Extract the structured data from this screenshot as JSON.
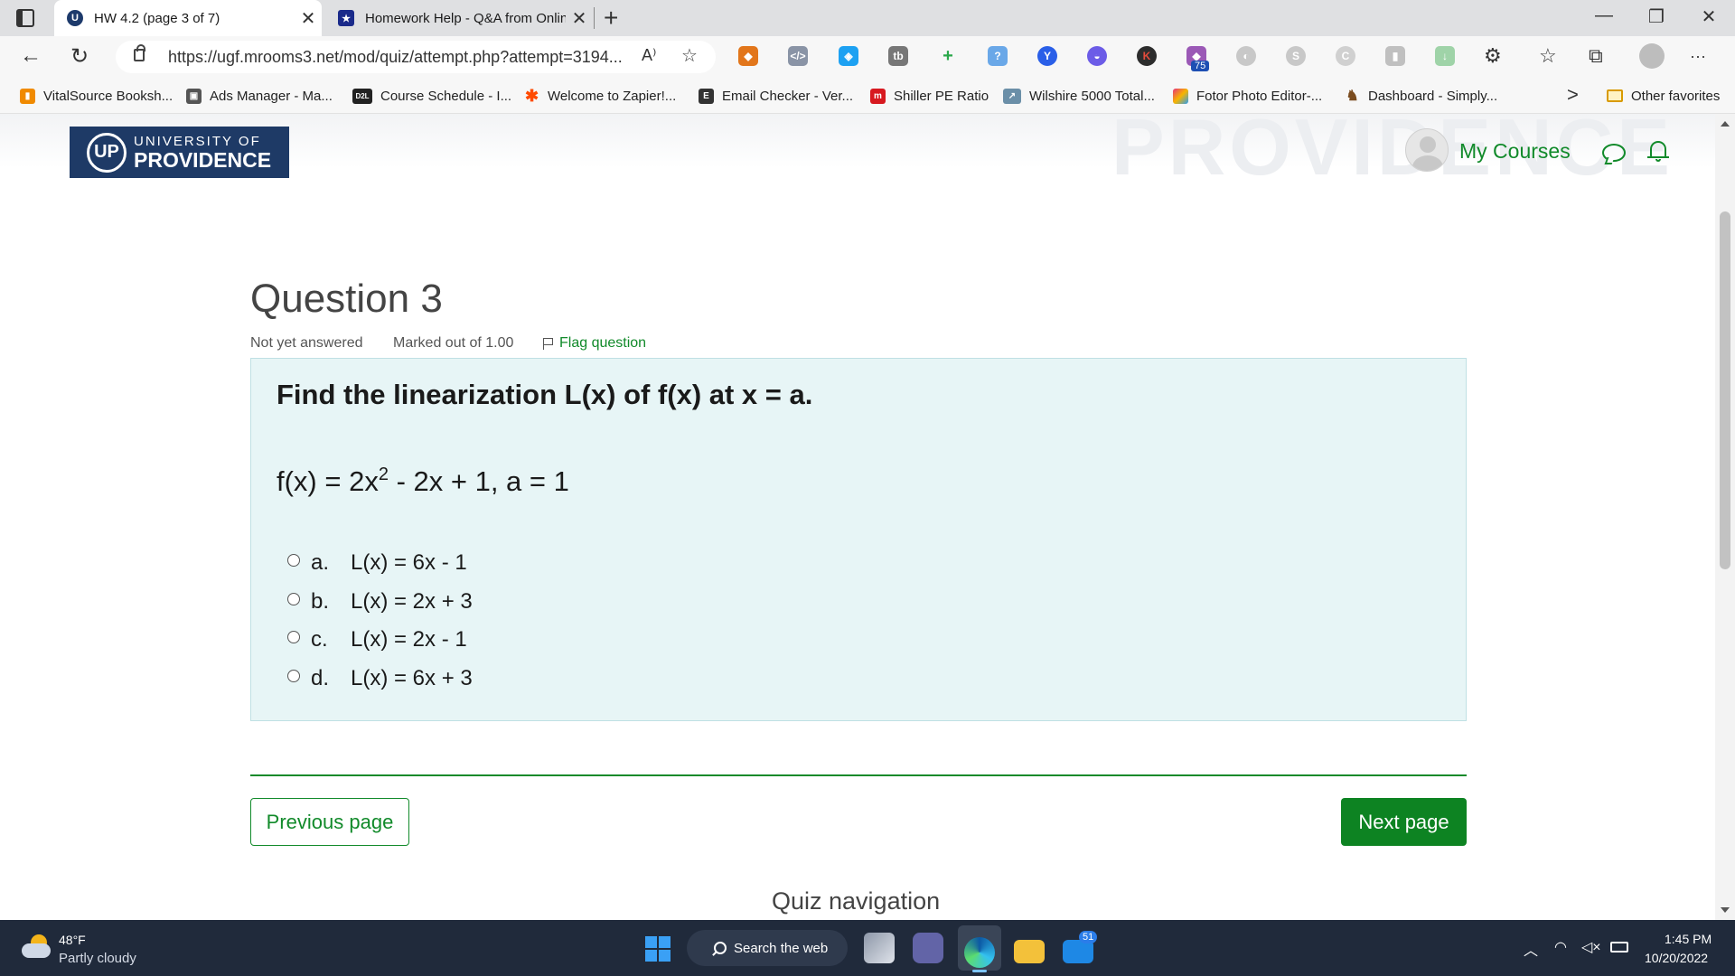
{
  "browser": {
    "tabs": [
      {
        "title": "HW 4.2 (page 3 of 7)",
        "active": true,
        "icon": "providence-logo-icon"
      },
      {
        "title": "Homework Help - Q&A from Online Tutors",
        "active": false,
        "icon": "star-badge-icon"
      }
    ],
    "close_glyph": "✕",
    "newtab_glyph": "+",
    "window_controls": {
      "minimize": "—",
      "restore": "❐",
      "close": "✕"
    },
    "nav": {
      "back": "←",
      "refresh": "↻"
    },
    "url": "https://ugf.mrooms3.net/mod/quiz/attempt.php?attempt=3194...",
    "read_aloud": "A⁾",
    "add_favorite": "☆",
    "extension_badge": "75",
    "toolbar_icons": {
      "extensions": "⚙",
      "favorites": "☆",
      "collections": "⧉",
      "more": "···"
    },
    "favorites": [
      {
        "label": "VitalSource Booksh...",
        "color": "#f08a00",
        "glyph": "▮"
      },
      {
        "label": "Ads Manager - Ma...",
        "color": "#555555",
        "glyph": "▣"
      },
      {
        "label": "Course Schedule - I...",
        "color": "#222222",
        "glyph": "D2L"
      },
      {
        "label": "Welcome to Zapier!...",
        "color": "#ff4a00",
        "glyph": "✱"
      },
      {
        "label": "Email Checker - Ver...",
        "color": "#333333",
        "glyph": "E"
      },
      {
        "label": "Shiller PE Ratio",
        "color": "#d71920",
        "glyph": "m"
      },
      {
        "label": "Wilshire 5000 Total...",
        "color": "#6b8fa8",
        "glyph": "↗"
      },
      {
        "label": "Fotor Photo Editor-...",
        "color": "#e8327c",
        "glyph": "■"
      },
      {
        "label": "Dashboard - Simply...",
        "color": "#7a4b1e",
        "glyph": "♞"
      }
    ],
    "favorites_more": ">",
    "other_favorites": "Other favorites"
  },
  "site": {
    "logo_top": "UNIVERSITY OF",
    "logo_bottom": "PROVIDENCE",
    "logo_mark": "UP",
    "watermark": "PROVIDENCE",
    "my_courses": "My Courses"
  },
  "question": {
    "heading": "Question 3",
    "state": "Not yet answered",
    "marked_out_of": "Marked out of 1.00",
    "flag_label": "Flag question",
    "prompt": "Find the linearization L(x) of f(x) at x = a.",
    "function_prefix": "f(x) = 2x",
    "function_exponent": "2",
    "function_suffix": " - 2x + 1, a = 1",
    "options": [
      {
        "letter": "a.",
        "text": "L(x) = 6x - 1"
      },
      {
        "letter": "b.",
        "text": "L(x) = 2x + 3"
      },
      {
        "letter": "c.",
        "text": "L(x) = 2x - 1"
      },
      {
        "letter": "d.",
        "text": "L(x) = 6x + 3"
      }
    ]
  },
  "navigation": {
    "previous": "Previous page",
    "next": "Next page",
    "quiz_navigation": "Quiz navigation"
  },
  "taskbar": {
    "temperature": "48°F",
    "weather": "Partly cloudy",
    "search": "Search the web",
    "mail_badge": "51",
    "time": "1:45 PM",
    "date": "10/20/2022"
  },
  "colors": {
    "accent_green": "#118a2a",
    "next_button": "#0d8322",
    "question_bg": "#e7f5f6",
    "logo_navy": "#1e3a66"
  }
}
